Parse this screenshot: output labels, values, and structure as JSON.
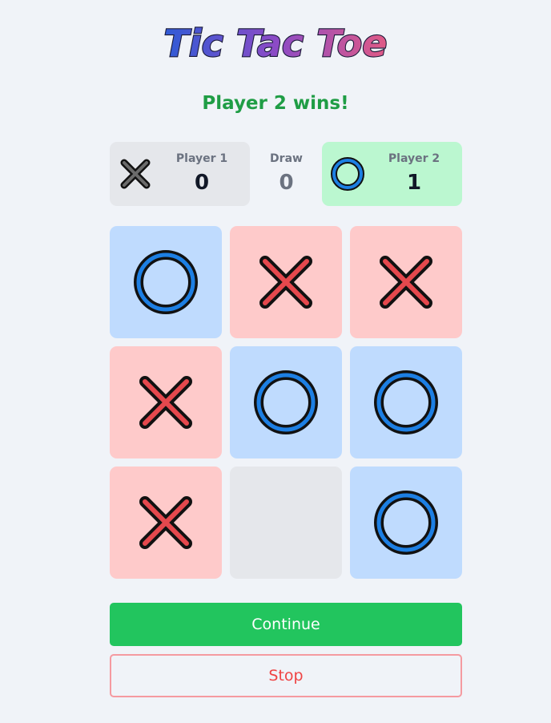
{
  "game": {
    "title": "Tic Tac Toe",
    "status_text": "Player 2 wins!"
  },
  "scores": {
    "player1": {
      "label": "Player 1",
      "value": "0",
      "mark": "x-icon"
    },
    "draw": {
      "label": "Draw",
      "value": "0"
    },
    "player2": {
      "label": "Player 2",
      "value": "1",
      "mark": "o-icon"
    }
  },
  "board": {
    "cells": [
      "O",
      "X",
      "X",
      "X",
      "O",
      "O",
      "X",
      "",
      "O"
    ]
  },
  "buttons": {
    "continue_label": "Continue",
    "stop_label": "Stop"
  },
  "colors": {
    "x_cell": "#fecaca",
    "o_cell": "#bfdbfe",
    "empty_cell": "#e5e7eb",
    "winner_card": "#bbf7d0",
    "status_green": "#1f9d45",
    "continue_button": "#22c55e",
    "stop_text": "#ef4444"
  }
}
